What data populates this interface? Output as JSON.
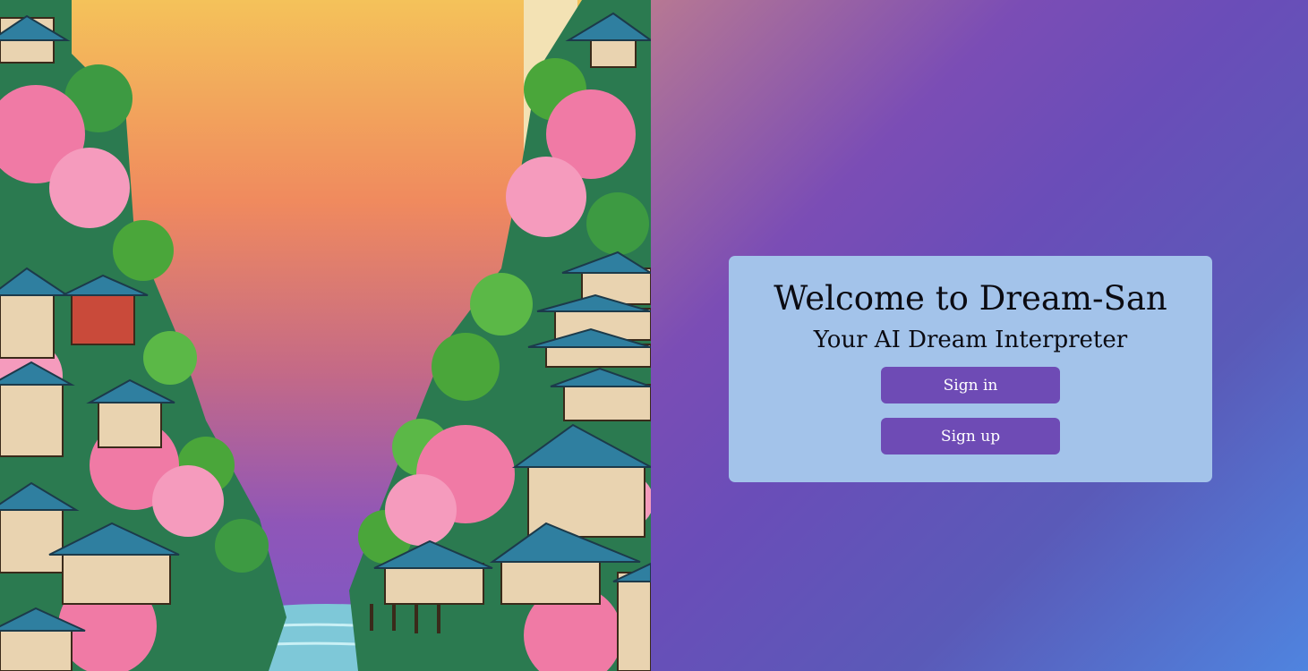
{
  "hero": {
    "image": "japanese-village-cherry-blossom-illustration",
    "colors": {
      "sky_top": "#f4c25a",
      "sky_mid": "#f08a5e",
      "sky_bottom": "#7a58c8",
      "roof": "#2f7fa0",
      "blossom": "#f07aa5",
      "foliage": "#4aa63a",
      "water": "#7ec8d8"
    }
  },
  "welcome": {
    "title": "Welcome to Dream-San",
    "subtitle": "Your AI Dream Interpreter",
    "signin_label": "Sign in",
    "signup_label": "Sign up"
  },
  "colors": {
    "card_bg": "#a3c3ea",
    "button_bg": "#6e4bb5",
    "button_text": "#ffffff",
    "panel_gradient_start": "#b77893",
    "panel_gradient_mid": "#6a4db8",
    "panel_gradient_end": "#4f84df"
  }
}
